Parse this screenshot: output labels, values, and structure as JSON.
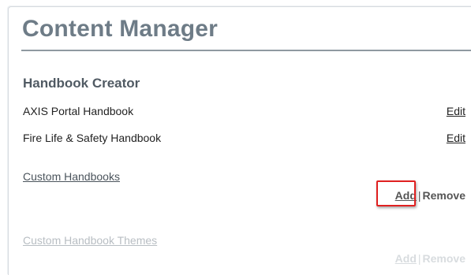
{
  "header": {
    "title": "Content Manager"
  },
  "handbook_creator": {
    "heading": "Handbook Creator",
    "items": [
      {
        "label": "AXIS Portal Handbook",
        "action": "Edit"
      },
      {
        "label": "Fire Life & Safety Handbook",
        "action": "Edit"
      }
    ]
  },
  "custom_handbooks": {
    "label": "Custom Handbooks",
    "add": "Add",
    "separator": "|",
    "remove": "Remove"
  },
  "custom_handbook_themes": {
    "label": "Custom Handbook Themes",
    "add": "Add",
    "separator": "|",
    "remove": "Remove"
  },
  "colors": {
    "title": "#6e7c87",
    "highlight": "#e02020",
    "disabled_text": "#b8bec3"
  }
}
